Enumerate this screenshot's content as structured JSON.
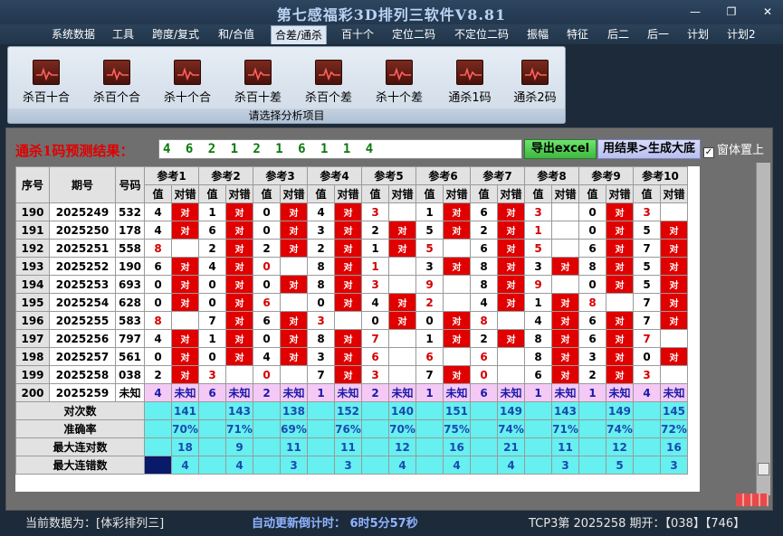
{
  "app": {
    "title": "第七感福彩3D排列三软件V8.81"
  },
  "window_controls": {
    "minimize": "—",
    "maximize": "❐",
    "close": "✕"
  },
  "menu": [
    {
      "label": "系统数据"
    },
    {
      "label": "工具"
    },
    {
      "label": "跨度/复式"
    },
    {
      "label": "和/合值"
    },
    {
      "label": "合差/通杀",
      "active": true
    },
    {
      "label": "百十个"
    },
    {
      "label": "定位二码"
    },
    {
      "label": "不定位二码"
    },
    {
      "label": "振幅"
    },
    {
      "label": "特征"
    },
    {
      "label": "后二"
    },
    {
      "label": "后一"
    },
    {
      "label": "计划"
    },
    {
      "label": "计划2"
    }
  ],
  "ribbon": {
    "buttons": [
      {
        "label": "杀百十合",
        "icon": "chart-icon"
      },
      {
        "label": "杀百个合",
        "icon": "chart-icon"
      },
      {
        "label": "杀十个合",
        "icon": "chart-icon"
      },
      {
        "label": "杀百十差",
        "icon": "chart-icon"
      },
      {
        "label": "杀百个差",
        "icon": "chart-icon"
      },
      {
        "label": "杀十个差",
        "icon": "chart-icon"
      },
      {
        "label": "通杀1码",
        "icon": "chart-icon"
      },
      {
        "label": "通杀2码",
        "icon": "chart-icon"
      }
    ],
    "footer": "请选择分析项目"
  },
  "prediction": {
    "label": "通杀1码预测结果：",
    "value": "4 6 2 1 2 1 6 1 1 4",
    "export_label": "导出excel",
    "apply_label": "用结果>生成大底",
    "ontop_label": "窗体置上",
    "ontop_checked": "✓"
  },
  "grid": {
    "headers": {
      "seq": "序号",
      "period": "期号",
      "number": "号码",
      "value": "值",
      "hit": "对错"
    },
    "refs": [
      "参考1",
      "参考2",
      "参考3",
      "参考4",
      "参考5",
      "参考6",
      "参考7",
      "参考8",
      "参考9",
      "参考10"
    ],
    "rows": [
      {
        "seq": "190",
        "period": "2025249",
        "num": "532",
        "cells": [
          [
            "4",
            "对"
          ],
          [
            "1",
            "对"
          ],
          [
            "0",
            "对"
          ],
          [
            "4",
            "对"
          ],
          [
            "3",
            ""
          ],
          [
            "1",
            "对"
          ],
          [
            "6",
            "对"
          ],
          [
            "3",
            ""
          ],
          [
            "0",
            "对"
          ],
          [
            "3",
            ""
          ]
        ]
      },
      {
        "seq": "191",
        "period": "2025250",
        "num": "178",
        "cells": [
          [
            "4",
            "对"
          ],
          [
            "6",
            "对"
          ],
          [
            "0",
            "对"
          ],
          [
            "3",
            "对"
          ],
          [
            "2",
            "对"
          ],
          [
            "5",
            "对"
          ],
          [
            "2",
            "对"
          ],
          [
            "1",
            ""
          ],
          [
            "0",
            "对"
          ],
          [
            "5",
            "对"
          ]
        ]
      },
      {
        "seq": "192",
        "period": "2025251",
        "num": "558",
        "cells": [
          [
            "8",
            ""
          ],
          [
            "2",
            "对"
          ],
          [
            "2",
            "对"
          ],
          [
            "2",
            "对"
          ],
          [
            "1",
            "对"
          ],
          [
            "5",
            ""
          ],
          [
            "6",
            "对"
          ],
          [
            "5",
            ""
          ],
          [
            "6",
            "对"
          ],
          [
            "7",
            "对"
          ]
        ]
      },
      {
        "seq": "193",
        "period": "2025252",
        "num": "190",
        "cells": [
          [
            "6",
            "对"
          ],
          [
            "4",
            "对"
          ],
          [
            "0",
            ""
          ],
          [
            "8",
            "对"
          ],
          [
            "1",
            ""
          ],
          [
            "3",
            "对"
          ],
          [
            "8",
            "对"
          ],
          [
            "3",
            "对"
          ],
          [
            "8",
            "对"
          ],
          [
            "5",
            "对"
          ]
        ]
      },
      {
        "seq": "194",
        "period": "2025253",
        "num": "693",
        "cells": [
          [
            "0",
            "对"
          ],
          [
            "0",
            "对"
          ],
          [
            "0",
            "对"
          ],
          [
            "8",
            "对"
          ],
          [
            "3",
            ""
          ],
          [
            "9",
            ""
          ],
          [
            "8",
            "对"
          ],
          [
            "9",
            ""
          ],
          [
            "0",
            "对"
          ],
          [
            "5",
            "对"
          ]
        ]
      },
      {
        "seq": "195",
        "period": "2025254",
        "num": "628",
        "cells": [
          [
            "0",
            "对"
          ],
          [
            "0",
            "对"
          ],
          [
            "6",
            ""
          ],
          [
            "0",
            "对"
          ],
          [
            "4",
            "对"
          ],
          [
            "2",
            ""
          ],
          [
            "4",
            "对"
          ],
          [
            "1",
            "对"
          ],
          [
            "8",
            ""
          ],
          [
            "7",
            "对"
          ]
        ]
      },
      {
        "seq": "196",
        "period": "2025255",
        "num": "583",
        "cells": [
          [
            "8",
            ""
          ],
          [
            "7",
            "对"
          ],
          [
            "6",
            "对"
          ],
          [
            "3",
            ""
          ],
          [
            "0",
            "对"
          ],
          [
            "0",
            "对"
          ],
          [
            "8",
            ""
          ],
          [
            "4",
            "对"
          ],
          [
            "6",
            "对"
          ],
          [
            "7",
            "对"
          ]
        ]
      },
      {
        "seq": "197",
        "period": "2025256",
        "num": "797",
        "cells": [
          [
            "4",
            "对"
          ],
          [
            "1",
            "对"
          ],
          [
            "0",
            "对"
          ],
          [
            "8",
            "对"
          ],
          [
            "7",
            ""
          ],
          [
            "1",
            "对"
          ],
          [
            "2",
            "对"
          ],
          [
            "8",
            "对"
          ],
          [
            "6",
            "对"
          ],
          [
            "7",
            ""
          ]
        ]
      },
      {
        "seq": "198",
        "period": "2025257",
        "num": "561",
        "cells": [
          [
            "0",
            "对"
          ],
          [
            "0",
            "对"
          ],
          [
            "4",
            "对"
          ],
          [
            "3",
            "对"
          ],
          [
            "6",
            ""
          ],
          [
            "6",
            ""
          ],
          [
            "6",
            ""
          ],
          [
            "8",
            "对"
          ],
          [
            "3",
            "对"
          ],
          [
            "0",
            "对"
          ]
        ]
      },
      {
        "seq": "199",
        "period": "2025258",
        "num": "038",
        "cells": [
          [
            "2",
            "对"
          ],
          [
            "3",
            ""
          ],
          [
            "0",
            ""
          ],
          [
            "7",
            "对"
          ],
          [
            "3",
            ""
          ],
          [
            "7",
            "对"
          ],
          [
            "0",
            ""
          ],
          [
            "6",
            "对"
          ],
          [
            "2",
            "对"
          ],
          [
            "3",
            ""
          ]
        ]
      },
      {
        "seq": "200",
        "period": "2025259",
        "num": "未知",
        "cells": [
          [
            "4",
            "未知"
          ],
          [
            "6",
            "未知"
          ],
          [
            "2",
            "未知"
          ],
          [
            "1",
            "未知"
          ],
          [
            "2",
            "未知"
          ],
          [
            "1",
            "未知"
          ],
          [
            "6",
            "未知"
          ],
          [
            "1",
            "未知"
          ],
          [
            "1",
            "未知"
          ],
          [
            "4",
            "未知"
          ]
        ]
      }
    ],
    "stats": [
      {
        "label": "对次数",
        "values": [
          "141",
          "143",
          "138",
          "152",
          "140",
          "151",
          "149",
          "143",
          "149",
          "145"
        ]
      },
      {
        "label": "准确率",
        "values": [
          "70%",
          "71%",
          "69%",
          "76%",
          "70%",
          "75%",
          "74%",
          "71%",
          "74%",
          "72%"
        ]
      },
      {
        "label": "最大连对数",
        "values": [
          "18",
          "9",
          "11",
          "11",
          "12",
          "16",
          "21",
          "11",
          "12",
          "16"
        ]
      },
      {
        "label": "最大连错数",
        "values": [
          "4",
          "4",
          "3",
          "3",
          "4",
          "4",
          "4",
          "3",
          "5",
          "3"
        ]
      }
    ]
  },
  "status": {
    "current": "当前数据为：[体彩排列三]",
    "countdown": "自动更新倒计时：  6时5分57秒",
    "issue": "TCP3第  2025258  期开：【038】【746】"
  },
  "colors": {
    "accent_red": "#e00000",
    "pink": "#f5c9f5",
    "cyan": "#66f0f0",
    "navy": "#0a1a6a"
  }
}
